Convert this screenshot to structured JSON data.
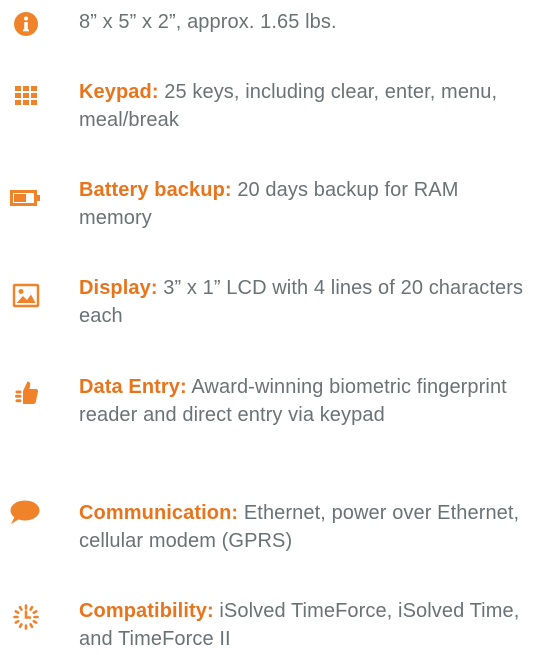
{
  "accent_color": "#f0832a",
  "label_color": "#e8741c",
  "text_color": "#6b7275",
  "specs": [
    {
      "icon": "info-icon",
      "label": "",
      "text": "8” x 5” x 2”, approx. 1.65 lbs."
    },
    {
      "icon": "keypad-icon",
      "label": "Keypad:",
      "text": " 25 keys, including clear, enter, menu, meal/break"
    },
    {
      "icon": "battery-icon",
      "label": "Battery backup:",
      "text": " 20 days backup for RAM memory"
    },
    {
      "icon": "image-icon",
      "label": "Display:",
      "text": " 3” x 1” LCD with 4 lines of 20 characters each"
    },
    {
      "icon": "thumbs-up-icon",
      "label": "Data Entry:",
      "text": " Award-winning biometric fingerprint reader and direct entry via keypad"
    },
    {
      "icon": "speech-bubble-icon",
      "label": "Communication:",
      "text": " Ethernet, power over Ethernet, cellular modem (GPRS)"
    },
    {
      "icon": "clock-icon",
      "label": "Compatibility:",
      "text": " iSolved TimeForce, iSolved Time, and TimeForce II"
    }
  ]
}
